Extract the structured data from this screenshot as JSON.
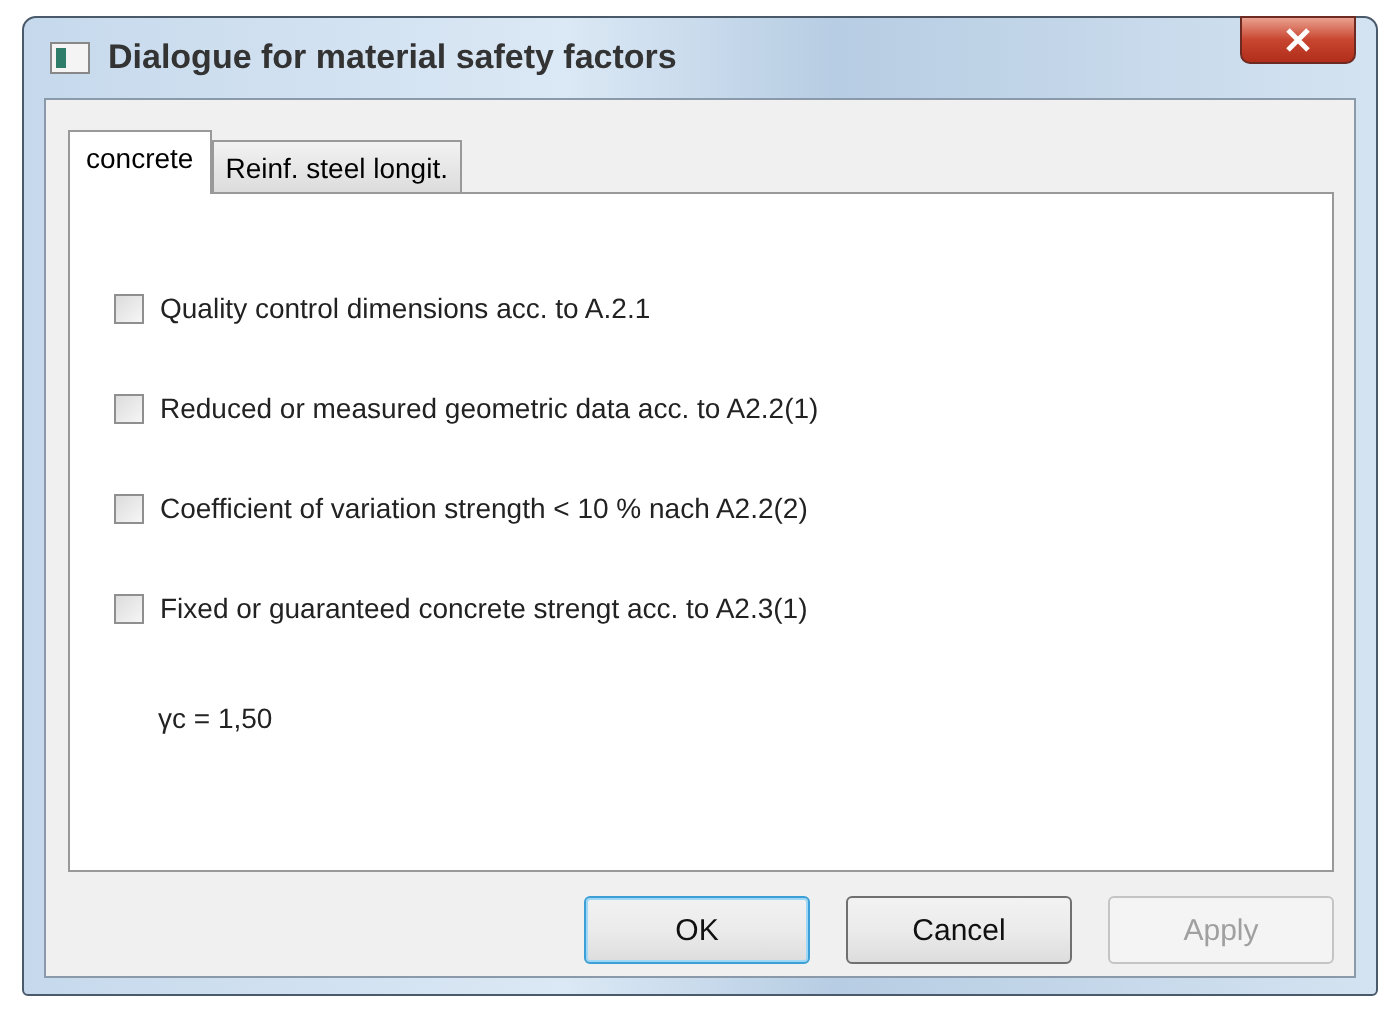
{
  "window": {
    "title": "Dialogue for material safety factors"
  },
  "tabs": [
    {
      "label": "concrete",
      "selected": true
    },
    {
      "label": "Reinf. steel longit.",
      "selected": false
    }
  ],
  "options": [
    {
      "label": "Quality control dimensions acc. to A.2.1",
      "checked": false
    },
    {
      "label": "Reduced or measured geometric data acc. to A2.2(1)",
      "checked": false
    },
    {
      "label": "Coefficient of variation strength < 10 % nach A2.2(2)",
      "checked": false
    },
    {
      "label": "Fixed or guaranteed concrete strengt acc. to A2.3(1)",
      "checked": false
    }
  ],
  "result": "γc = 1,50",
  "buttons": [
    {
      "label": "OK",
      "default": true,
      "disabled": false
    },
    {
      "label": "Cancel",
      "default": false,
      "disabled": false
    },
    {
      "label": "Apply",
      "default": false,
      "disabled": true
    }
  ]
}
